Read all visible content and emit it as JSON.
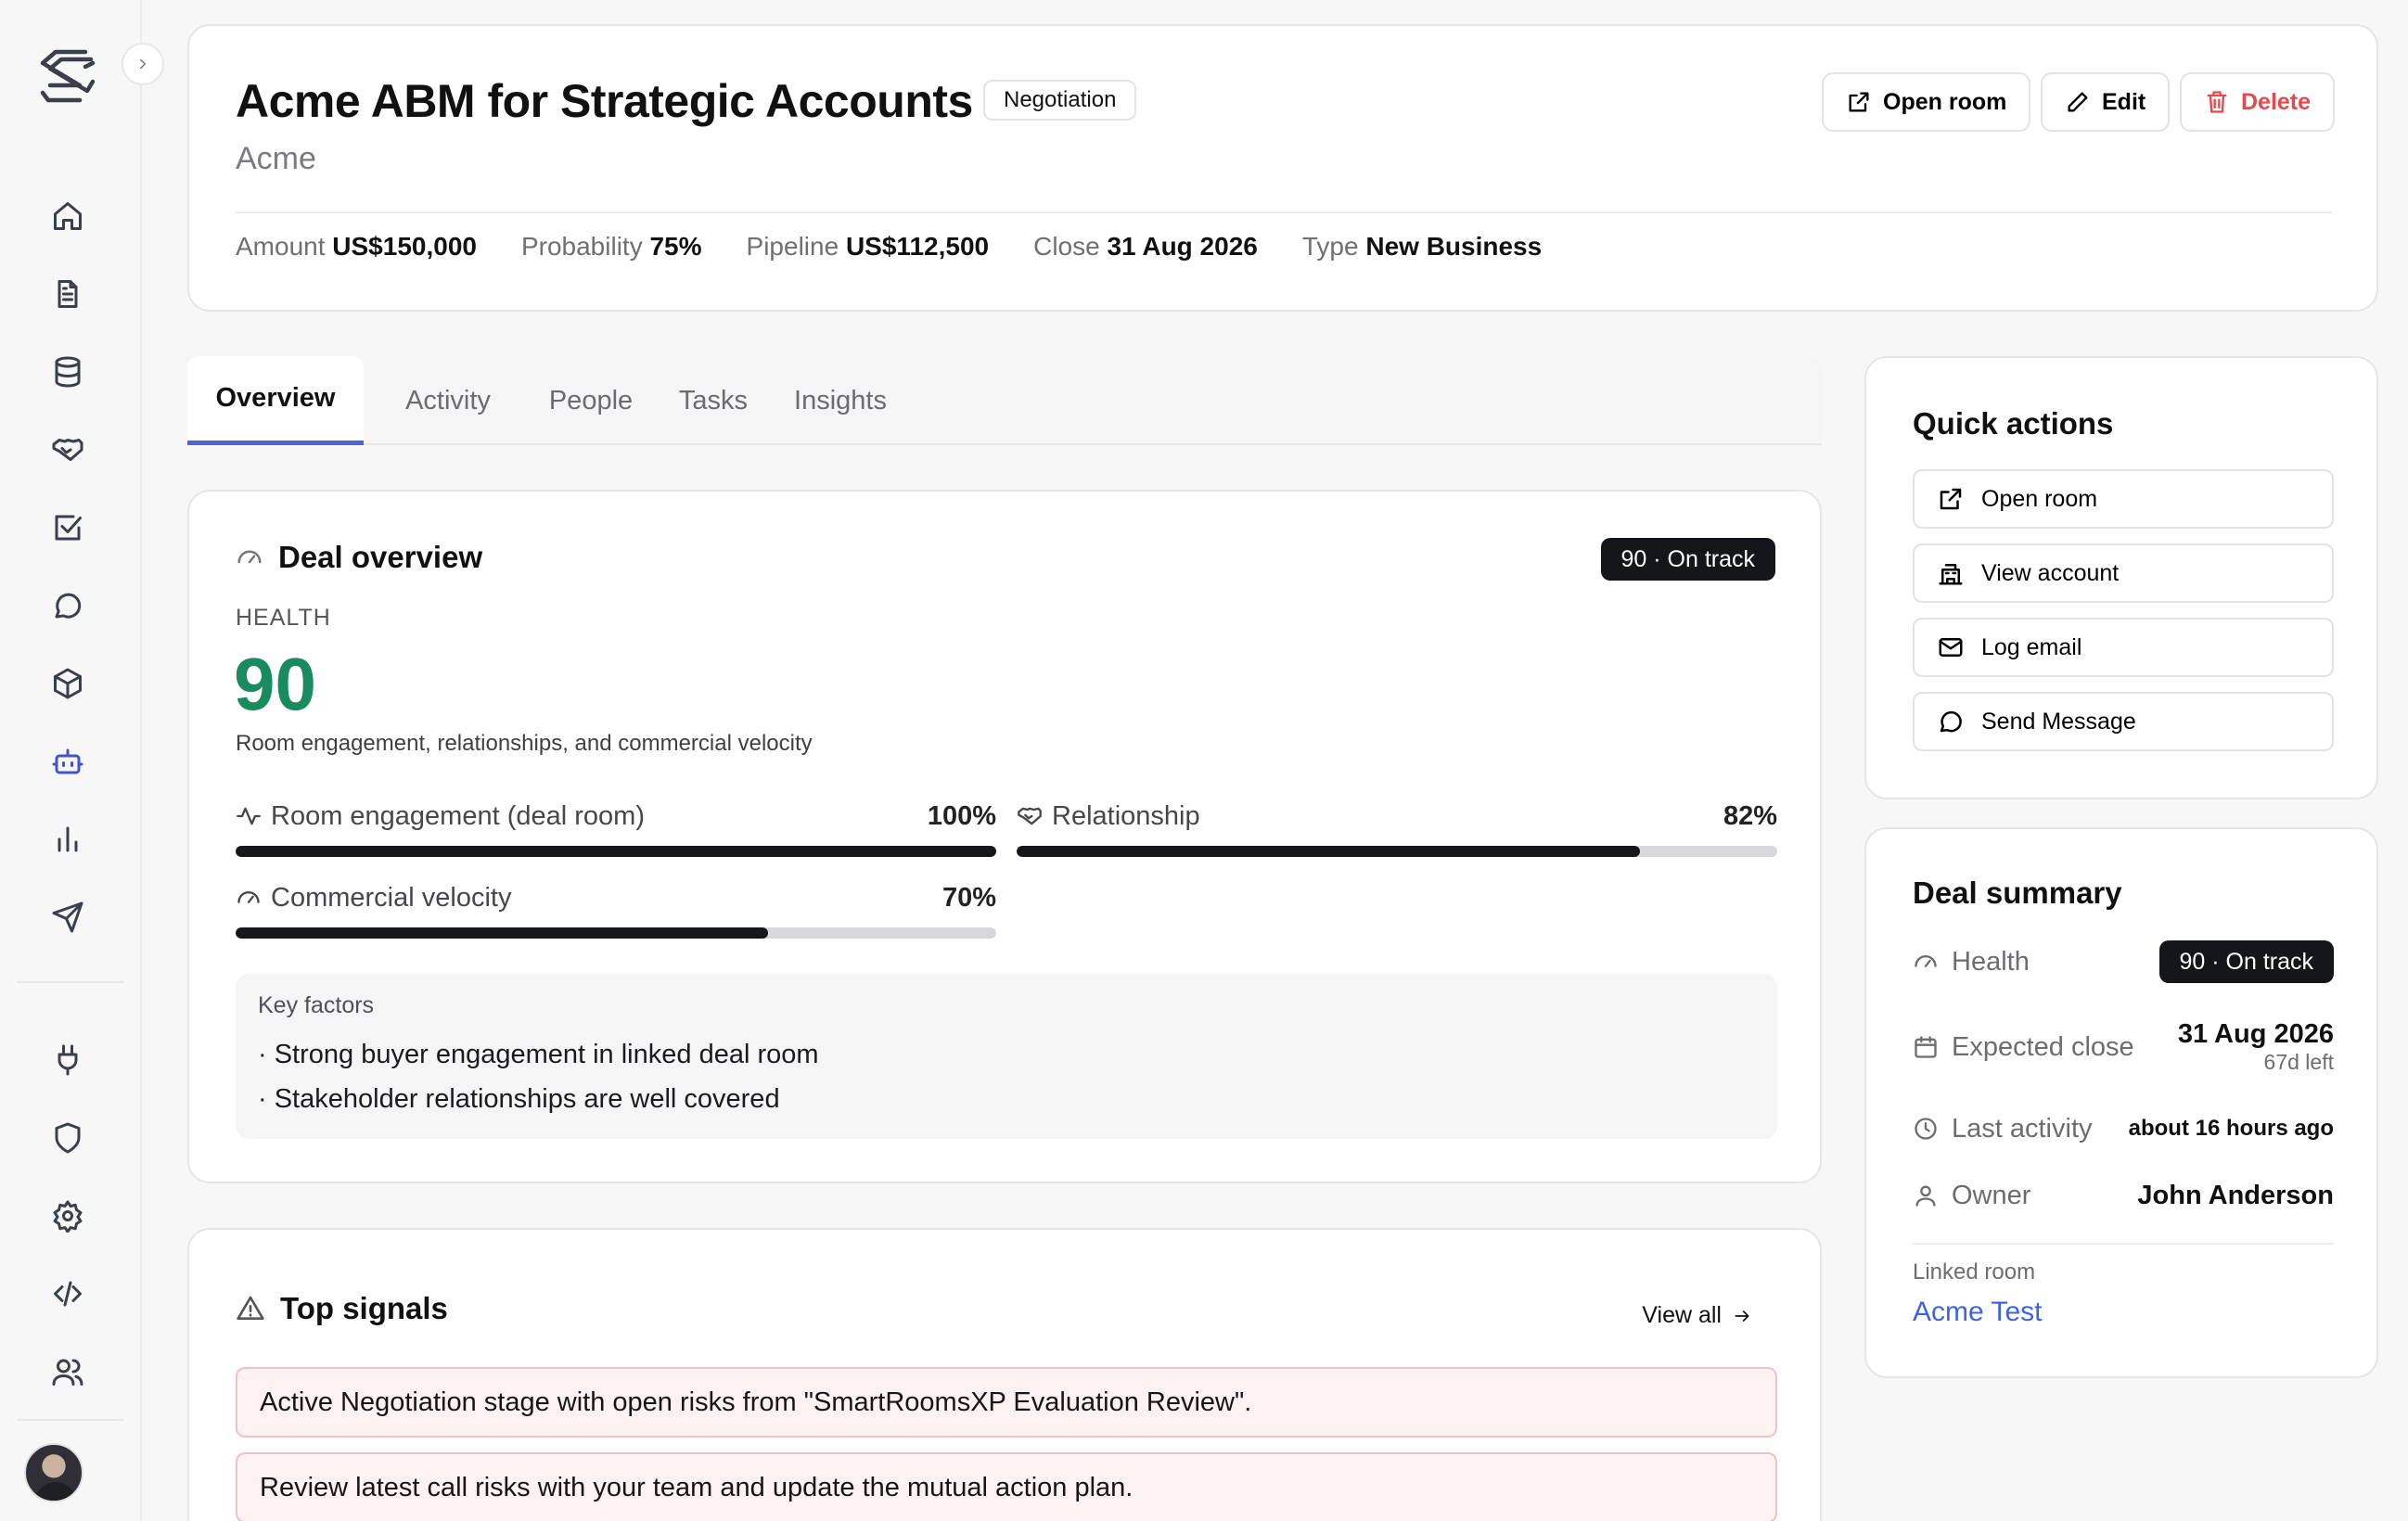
{
  "deal": {
    "title": "Acme ABM for Strategic Accounts",
    "stage": "Negotiation",
    "company": "Acme"
  },
  "header_actions": {
    "open_room": "Open room",
    "edit": "Edit",
    "delete": "Delete"
  },
  "stats": [
    {
      "label": "Amount",
      "value": "US$150,000"
    },
    {
      "label": "Probability",
      "value": "75%"
    },
    {
      "label": "Pipeline",
      "value": "US$112,500"
    },
    {
      "label": "Close",
      "value": "31 Aug 2026"
    },
    {
      "label": "Type",
      "value": "New Business"
    }
  ],
  "tabs": [
    "Overview",
    "Activity",
    "People",
    "Tasks",
    "Insights"
  ],
  "active_tab": "Overview",
  "overview": {
    "title": "Deal overview",
    "status_pill": "90 · On track",
    "health_label": "HEALTH",
    "health_score": "90",
    "health_description": "Room engagement, relationships, and commercial velocity",
    "metrics": [
      {
        "name": "Room engagement (deal room)",
        "value": "100%",
        "fraction": 1.0,
        "icon": "activity-icon"
      },
      {
        "name": "Relationship",
        "value": "82%",
        "fraction": 0.82,
        "icon": "handshake-icon"
      },
      {
        "name": "Commercial velocity",
        "value": "70%",
        "fraction": 0.7,
        "icon": "gauge-icon"
      }
    ],
    "key_factors_title": "Key factors",
    "key_factors": [
      "· Strong buyer engagement in linked deal room",
      "· Stakeholder relationships are well covered"
    ]
  },
  "signals": {
    "title": "Top signals",
    "view_all": "View all",
    "items": [
      "Active Negotiation stage with open risks from \"SmartRoomsXP Evaluation Review\".",
      "Review latest call risks with your team and update the mutual action plan."
    ]
  },
  "quick_actions": {
    "title": "Quick actions",
    "items": [
      {
        "label": "Open room",
        "icon": "external-link-icon"
      },
      {
        "label": "View account",
        "icon": "building-icon"
      },
      {
        "label": "Log email",
        "icon": "mail-icon"
      },
      {
        "label": "Send Message",
        "icon": "message-icon"
      }
    ]
  },
  "deal_summary": {
    "title": "Deal summary",
    "health_label": "Health",
    "health_value": "90 · On track",
    "expected_close_label": "Expected close",
    "expected_close_value": "31 Aug 2026",
    "expected_close_sub": "67d left",
    "last_activity_label": "Last activity",
    "last_activity_value": "about 16 hours ago",
    "owner_label": "Owner",
    "owner_value": "John Anderson",
    "linked_room_label": "Linked room",
    "linked_room_value": "Acme Test"
  },
  "sidebar": {
    "items": [
      {
        "icon": "home-icon"
      },
      {
        "icon": "document-icon"
      },
      {
        "icon": "database-icon"
      },
      {
        "icon": "handshake-icon"
      },
      {
        "icon": "checkbox-icon"
      },
      {
        "icon": "chat-icon"
      },
      {
        "icon": "package-icon"
      },
      {
        "icon": "bot-icon",
        "active": true
      },
      {
        "icon": "bar-chart-icon"
      },
      {
        "icon": "send-icon"
      },
      {
        "icon": "plug-icon"
      },
      {
        "icon": "shield-icon"
      },
      {
        "icon": "settings-icon"
      },
      {
        "icon": "code-icon"
      },
      {
        "icon": "users-icon"
      }
    ]
  },
  "colors": {
    "accent": "#4e63d8",
    "health_green": "#1a8a5f",
    "danger": "#e5484d",
    "link": "#3f63e0",
    "pill_dark": "#15161a",
    "signal_bg": "#fdf1f1"
  }
}
